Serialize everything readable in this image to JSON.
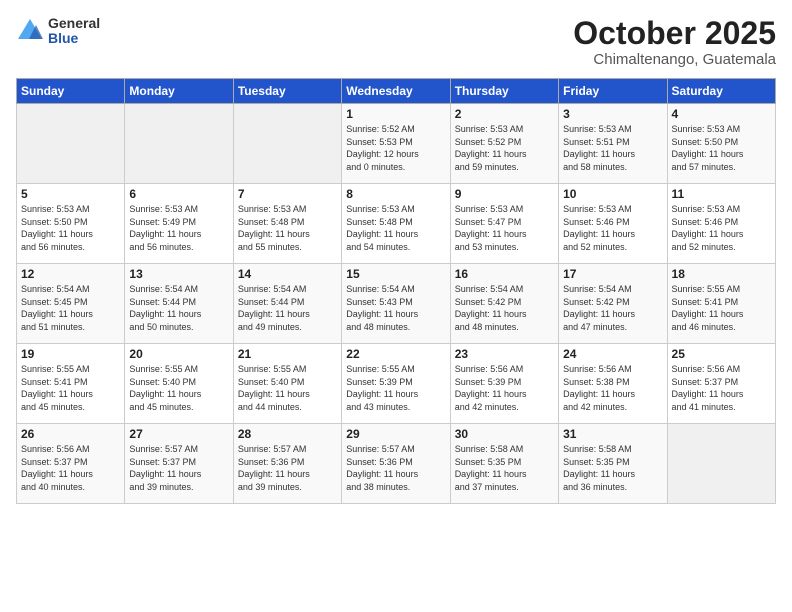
{
  "header": {
    "logo_general": "General",
    "logo_blue": "Blue",
    "month": "October 2025",
    "location": "Chimaltenango, Guatemala"
  },
  "weekdays": [
    "Sunday",
    "Monday",
    "Tuesday",
    "Wednesday",
    "Thursday",
    "Friday",
    "Saturday"
  ],
  "weeks": [
    [
      {
        "day": "",
        "info": ""
      },
      {
        "day": "",
        "info": ""
      },
      {
        "day": "",
        "info": ""
      },
      {
        "day": "1",
        "info": "Sunrise: 5:52 AM\nSunset: 5:53 PM\nDaylight: 12 hours\nand 0 minutes."
      },
      {
        "day": "2",
        "info": "Sunrise: 5:53 AM\nSunset: 5:52 PM\nDaylight: 11 hours\nand 59 minutes."
      },
      {
        "day": "3",
        "info": "Sunrise: 5:53 AM\nSunset: 5:51 PM\nDaylight: 11 hours\nand 58 minutes."
      },
      {
        "day": "4",
        "info": "Sunrise: 5:53 AM\nSunset: 5:50 PM\nDaylight: 11 hours\nand 57 minutes."
      }
    ],
    [
      {
        "day": "5",
        "info": "Sunrise: 5:53 AM\nSunset: 5:50 PM\nDaylight: 11 hours\nand 56 minutes."
      },
      {
        "day": "6",
        "info": "Sunrise: 5:53 AM\nSunset: 5:49 PM\nDaylight: 11 hours\nand 56 minutes."
      },
      {
        "day": "7",
        "info": "Sunrise: 5:53 AM\nSunset: 5:48 PM\nDaylight: 11 hours\nand 55 minutes."
      },
      {
        "day": "8",
        "info": "Sunrise: 5:53 AM\nSunset: 5:48 PM\nDaylight: 11 hours\nand 54 minutes."
      },
      {
        "day": "9",
        "info": "Sunrise: 5:53 AM\nSunset: 5:47 PM\nDaylight: 11 hours\nand 53 minutes."
      },
      {
        "day": "10",
        "info": "Sunrise: 5:53 AM\nSunset: 5:46 PM\nDaylight: 11 hours\nand 52 minutes."
      },
      {
        "day": "11",
        "info": "Sunrise: 5:53 AM\nSunset: 5:46 PM\nDaylight: 11 hours\nand 52 minutes."
      }
    ],
    [
      {
        "day": "12",
        "info": "Sunrise: 5:54 AM\nSunset: 5:45 PM\nDaylight: 11 hours\nand 51 minutes."
      },
      {
        "day": "13",
        "info": "Sunrise: 5:54 AM\nSunset: 5:44 PM\nDaylight: 11 hours\nand 50 minutes."
      },
      {
        "day": "14",
        "info": "Sunrise: 5:54 AM\nSunset: 5:44 PM\nDaylight: 11 hours\nand 49 minutes."
      },
      {
        "day": "15",
        "info": "Sunrise: 5:54 AM\nSunset: 5:43 PM\nDaylight: 11 hours\nand 48 minutes."
      },
      {
        "day": "16",
        "info": "Sunrise: 5:54 AM\nSunset: 5:42 PM\nDaylight: 11 hours\nand 48 minutes."
      },
      {
        "day": "17",
        "info": "Sunrise: 5:54 AM\nSunset: 5:42 PM\nDaylight: 11 hours\nand 47 minutes."
      },
      {
        "day": "18",
        "info": "Sunrise: 5:55 AM\nSunset: 5:41 PM\nDaylight: 11 hours\nand 46 minutes."
      }
    ],
    [
      {
        "day": "19",
        "info": "Sunrise: 5:55 AM\nSunset: 5:41 PM\nDaylight: 11 hours\nand 45 minutes."
      },
      {
        "day": "20",
        "info": "Sunrise: 5:55 AM\nSunset: 5:40 PM\nDaylight: 11 hours\nand 45 minutes."
      },
      {
        "day": "21",
        "info": "Sunrise: 5:55 AM\nSunset: 5:40 PM\nDaylight: 11 hours\nand 44 minutes."
      },
      {
        "day": "22",
        "info": "Sunrise: 5:55 AM\nSunset: 5:39 PM\nDaylight: 11 hours\nand 43 minutes."
      },
      {
        "day": "23",
        "info": "Sunrise: 5:56 AM\nSunset: 5:39 PM\nDaylight: 11 hours\nand 42 minutes."
      },
      {
        "day": "24",
        "info": "Sunrise: 5:56 AM\nSunset: 5:38 PM\nDaylight: 11 hours\nand 42 minutes."
      },
      {
        "day": "25",
        "info": "Sunrise: 5:56 AM\nSunset: 5:37 PM\nDaylight: 11 hours\nand 41 minutes."
      }
    ],
    [
      {
        "day": "26",
        "info": "Sunrise: 5:56 AM\nSunset: 5:37 PM\nDaylight: 11 hours\nand 40 minutes."
      },
      {
        "day": "27",
        "info": "Sunrise: 5:57 AM\nSunset: 5:37 PM\nDaylight: 11 hours\nand 39 minutes."
      },
      {
        "day": "28",
        "info": "Sunrise: 5:57 AM\nSunset: 5:36 PM\nDaylight: 11 hours\nand 39 minutes."
      },
      {
        "day": "29",
        "info": "Sunrise: 5:57 AM\nSunset: 5:36 PM\nDaylight: 11 hours\nand 38 minutes."
      },
      {
        "day": "30",
        "info": "Sunrise: 5:58 AM\nSunset: 5:35 PM\nDaylight: 11 hours\nand 37 minutes."
      },
      {
        "day": "31",
        "info": "Sunrise: 5:58 AM\nSunset: 5:35 PM\nDaylight: 11 hours\nand 36 minutes."
      },
      {
        "day": "",
        "info": ""
      }
    ]
  ]
}
